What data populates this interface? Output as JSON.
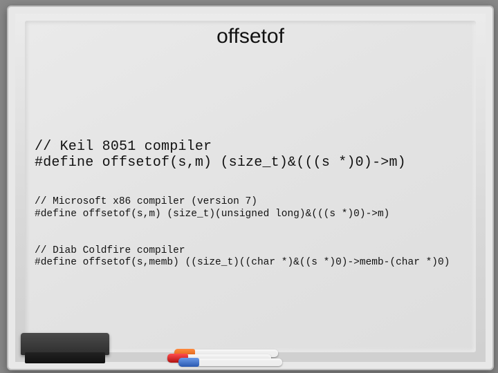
{
  "title": "offsetof",
  "blocks": [
    {
      "size": "large",
      "comment": "// Keil 8051 compiler",
      "code": "#define offsetof(s,m) (size_t)&(((s *)0)->m)"
    },
    {
      "size": "small",
      "comment": "// Microsoft x86 compiler (version 7)",
      "code": "#define offsetof(s,m) (size_t)(unsigned long)&(((s *)0)->m)"
    },
    {
      "size": "small",
      "comment": "// Diab Coldfire compiler",
      "code": "#define offsetof(s,memb) ((size_t)((char *)&((s *)0)->memb-(char *)0)"
    }
  ]
}
